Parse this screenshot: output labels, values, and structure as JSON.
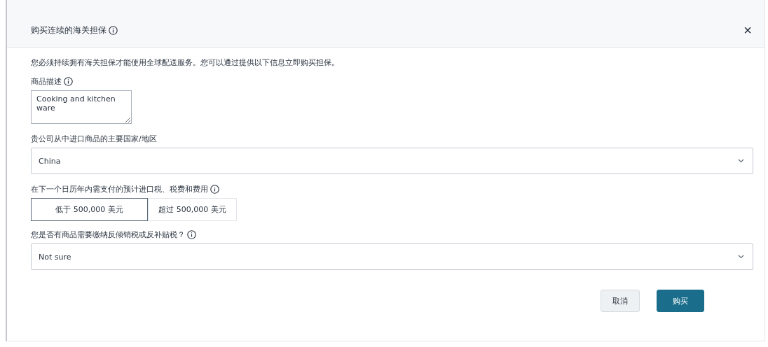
{
  "dialog": {
    "title": "购买连续的海关担保",
    "close": "×"
  },
  "intro": "您必须持续拥有海关担保才能使用全球配送服务。您可以通过提供以下信息立即购买担保。",
  "fields": [
    {
      "kind": "textarea",
      "label": "商品描述",
      "info": true,
      "value": "Cooking and kitchen ware"
    },
    {
      "kind": "select",
      "label": "贵公司从中进口商品的主要国家/地区",
      "info": false,
      "value": "China"
    },
    {
      "kind": "segmented",
      "label": "在下一个日历年内需支付的预计进口税、税费和费用",
      "info": true,
      "options": [
        {
          "label": "低于 500,000 美元",
          "selected": true
        },
        {
          "label": "超过 500,000 美元",
          "selected": false
        }
      ]
    },
    {
      "kind": "select",
      "label": "您是否有商品需要缴纳反倾销税或反补贴税？",
      "info": true,
      "value": "Not sure"
    }
  ],
  "buttons": [
    {
      "kind": "secondary",
      "label": "取消"
    },
    {
      "kind": "primary",
      "label": "购买"
    }
  ]
}
